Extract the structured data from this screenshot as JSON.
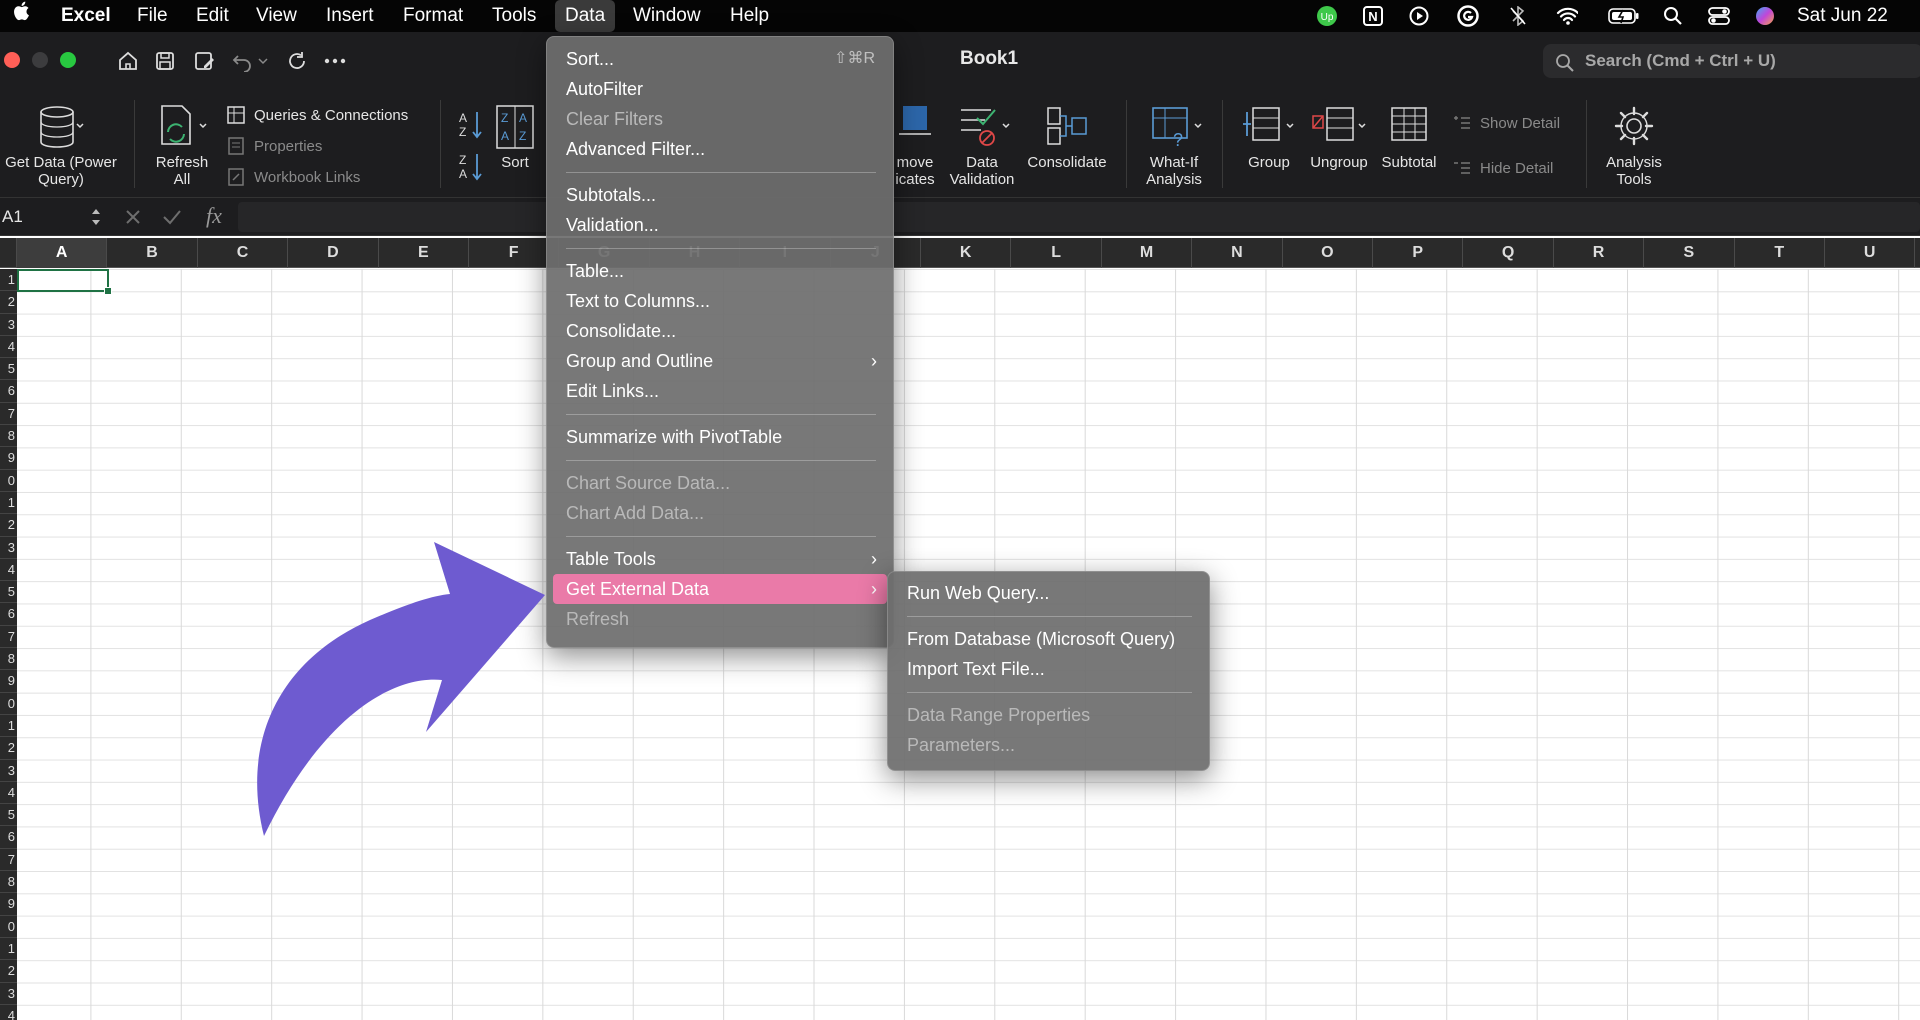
{
  "menubar": {
    "app": "Excel",
    "items": [
      "File",
      "Edit",
      "View",
      "Insert",
      "Format",
      "Tools",
      "Data",
      "Window",
      "Help"
    ],
    "open_item": "Data",
    "clock": "Sat Jun 22"
  },
  "window": {
    "title": "Book1",
    "search_placeholder": "Search (Cmd + Ctrl + U)"
  },
  "ribbon": {
    "get_data": "Get Data (Power Query)",
    "refresh_all": "Refresh All",
    "queries_connections": "Queries & Connections",
    "properties": "Properties",
    "workbook_links": "Workbook Links",
    "sort": "Sort",
    "remove_duplicates": "move icates",
    "data_validation": "Data Validation",
    "consolidate": "Consolidate",
    "what_if": "What-If Analysis",
    "group": "Group",
    "ungroup": "Ungroup",
    "subtotal": "Subtotal",
    "show_detail": "Show Detail",
    "hide_detail": "Hide Detail",
    "analysis_tools": "Analysis Tools"
  },
  "formula_bar": {
    "name_box": "A1",
    "fx": "fx"
  },
  "grid": {
    "columns": [
      "A",
      "B",
      "C",
      "D",
      "E",
      "F",
      "G",
      "H",
      "I",
      "J",
      "K",
      "L",
      "M",
      "N",
      "O",
      "P",
      "Q",
      "R",
      "S",
      "T",
      "U"
    ],
    "selected_column": "A",
    "row_labels": [
      "1",
      "2",
      "3",
      "4",
      "5",
      "6",
      "7",
      "8",
      "9",
      "0",
      "1",
      "2",
      "3",
      "4",
      "5",
      "6",
      "7",
      "8",
      "9",
      "0",
      "1",
      "2",
      "3",
      "4",
      "5",
      "6",
      "7",
      "8",
      "9",
      "0",
      "1",
      "2",
      "3",
      "4"
    ]
  },
  "data_menu": {
    "sort": "Sort...",
    "sort_shortcut": "⇧⌘R",
    "autofilter": "AutoFilter",
    "clear_filters": "Clear Filters",
    "advanced_filter": "Advanced Filter...",
    "subtotals": "Subtotals...",
    "validation": "Validation...",
    "table": "Table...",
    "text_to_columns": "Text to Columns...",
    "consolidate": "Consolidate...",
    "group_outline": "Group and Outline",
    "edit_links": "Edit Links...",
    "summarize_pivot": "Summarize with PivotTable",
    "chart_source": "Chart Source Data...",
    "chart_add": "Chart Add Data...",
    "table_tools": "Table Tools",
    "get_external": "Get External Data",
    "refresh": "Refresh",
    "highlight_color": "#ea7aa8"
  },
  "submenu": {
    "run_web_query": "Run Web Query...",
    "from_database": "From Database (Microsoft Query)",
    "import_text": "Import Text File...",
    "data_range_props": "Data Range Properties",
    "parameters": "Parameters..."
  },
  "annotation": {
    "arrow_color": "#6e5bd0"
  }
}
